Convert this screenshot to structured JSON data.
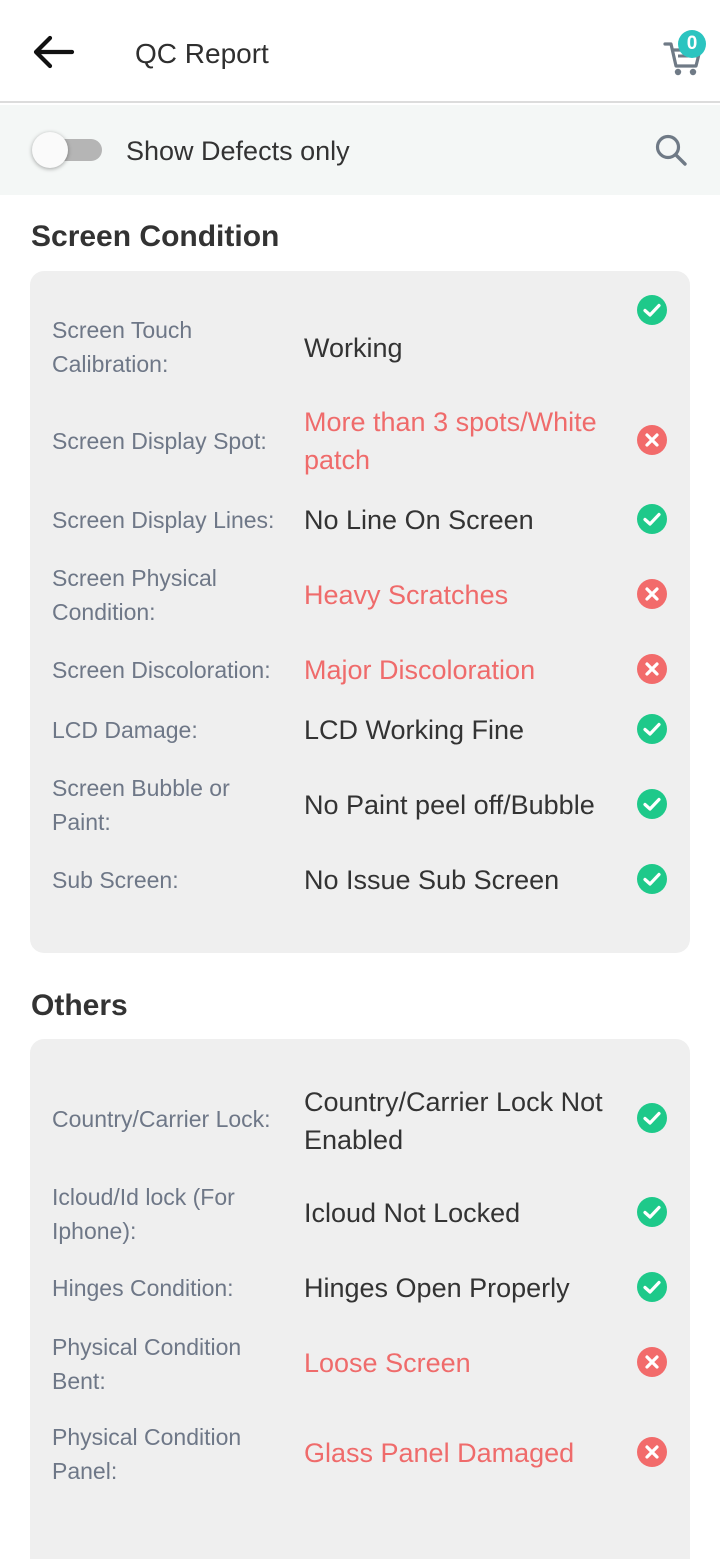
{
  "header": {
    "title": "QC Report",
    "cart_count": "0"
  },
  "filter": {
    "toggle_label": "Show Defects only",
    "toggle_on": false
  },
  "colors": {
    "ok": "#1ec98a",
    "defect": "#f26b6b",
    "defect_text": "#ef6b6b",
    "badge": "#2bc4c0"
  },
  "sections": [
    {
      "title": "Screen Condition",
      "rows": [
        {
          "label": "Screen Touch Calibration:",
          "value": "Working",
          "status": "ok"
        },
        {
          "label": "Screen Display Spot:",
          "value": "More than 3 spots/White patch",
          "status": "defect"
        },
        {
          "label": "Screen Display Lines:",
          "value": "No Line On Screen",
          "status": "ok"
        },
        {
          "label": "Screen Physical Condition:",
          "value": "Heavy Scratches",
          "status": "defect"
        },
        {
          "label": "Screen Discoloration:",
          "value": "Major Discoloration",
          "status": "defect"
        },
        {
          "label": "LCD Damage:",
          "value": "LCD Working Fine",
          "status": "ok"
        },
        {
          "label": "Screen Bubble or Paint:",
          "value": "No Paint peel off/Bubble",
          "status": "ok"
        },
        {
          "label": "Sub Screen:",
          "value": "No Issue Sub Screen",
          "status": "ok"
        }
      ]
    },
    {
      "title": "Others",
      "rows": [
        {
          "label": "Country/Carrier Lock:",
          "value": "Country/Carrier Lock Not Enabled",
          "status": "ok"
        },
        {
          "label": "Icloud/Id lock (For Iphone):",
          "value": "Icloud Not Locked",
          "status": "ok"
        },
        {
          "label": "Hinges Condition:",
          "value": "Hinges Open Properly",
          "status": "ok"
        },
        {
          "label": "Physical Condition Bent:",
          "value": "Loose Screen",
          "status": "defect"
        },
        {
          "label": "Physical Condition Panel:",
          "value": "Glass Panel Damaged",
          "status": "defect"
        }
      ]
    }
  ]
}
